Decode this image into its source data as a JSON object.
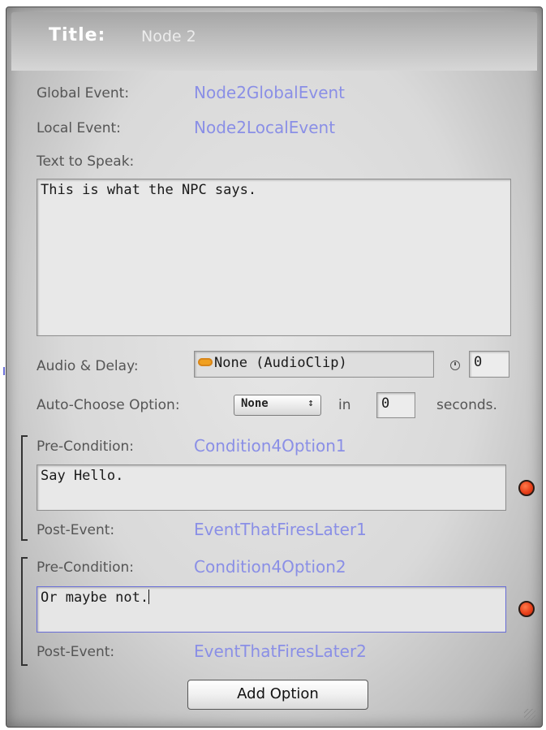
{
  "title": {
    "key": "Title:",
    "value": "Node 2"
  },
  "global_event": {
    "label": "Global Event:",
    "value": "Node2GlobalEvent"
  },
  "local_event": {
    "label": "Local Event:",
    "value": "Node2LocalEvent"
  },
  "text_to_speak": {
    "label": "Text to Speak:",
    "value": "This is what the NPC says."
  },
  "audio_delay": {
    "label": "Audio & Delay:",
    "clip": "None (AudioClip)",
    "delay": "0",
    "icon": "audio-clip-icon"
  },
  "auto_choose": {
    "label": "Auto-Choose Option:",
    "selected": "None",
    "arrows": "↕",
    "in_label": "in",
    "seconds_value": "0",
    "seconds_label": "seconds."
  },
  "options": [
    {
      "precondition_label": "Pre-Condition:",
      "precondition_value": "Condition4Option1",
      "text": "Say Hello.",
      "postevent_label": "Post-Event:",
      "postevent_value": "EventThatFiresLater1"
    },
    {
      "precondition_label": "Pre-Condition:",
      "precondition_value": "Condition4Option2",
      "text": "Or maybe not.",
      "postevent_label": "Post-Event:",
      "postevent_value": "EventThatFiresLater2"
    }
  ],
  "add_option_label": "Add Option",
  "colors": {
    "link": "#8a8fe6",
    "dot": "#e8401a",
    "focus_border": "#6a6fd8"
  }
}
